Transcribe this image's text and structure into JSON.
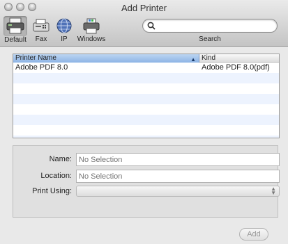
{
  "window": {
    "title": "Add Printer"
  },
  "toolbar": {
    "items": [
      {
        "label": "Default",
        "icon": "default-printer-icon"
      },
      {
        "label": "Fax",
        "icon": "fax-icon"
      },
      {
        "label": "IP",
        "icon": "ip-globe-icon"
      },
      {
        "label": "Windows",
        "icon": "windows-printer-icon"
      }
    ],
    "search_value": "",
    "search_label": "Search"
  },
  "table": {
    "columns": [
      "Printer Name",
      "Kind"
    ],
    "rows": [
      {
        "name": "Adobe PDF 8.0",
        "kind": "Adobe PDF 8.0(pdf)"
      }
    ]
  },
  "form": {
    "name_label": "Name:",
    "name_placeholder": "No Selection",
    "location_label": "Location:",
    "location_placeholder": "No Selection",
    "print_using_label": "Print Using:"
  },
  "buttons": {
    "add_label": "Add"
  }
}
